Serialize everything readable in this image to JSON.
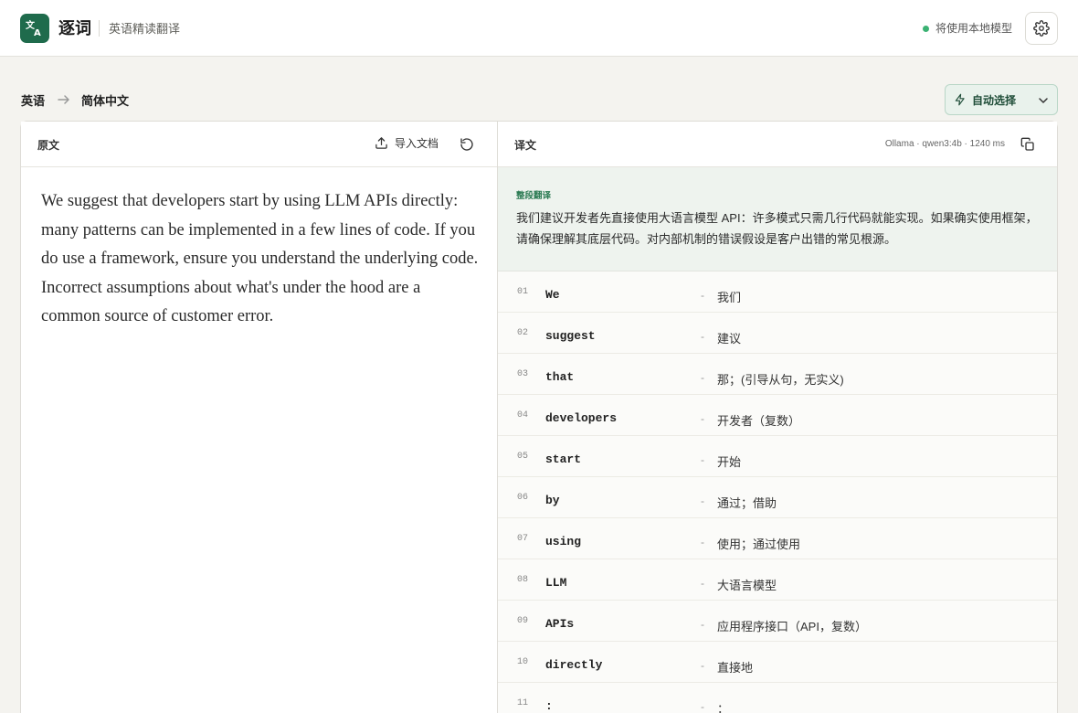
{
  "app": {
    "name": "逐词",
    "tagline": "英语精读翻译",
    "status_text": "将使用本地模型",
    "status_color": "#3bb273",
    "brand_color": "#1f6b4c",
    "logo_icon": "translate-icon",
    "settings_icon": "gear-icon"
  },
  "language": {
    "source": "英语",
    "target": "简体中文",
    "arrow_icon": "arrow-right-icon"
  },
  "model_select": {
    "label": "自动选择",
    "icon": "lightning-icon"
  },
  "source_panel": {
    "title": "原文",
    "import_label": "导入文档",
    "import_icon": "upload-icon",
    "reset_icon": "reset-icon",
    "text": "We suggest that developers start by using LLM APIs directly: many patterns can be implemented in a few lines of code. If you do use a framework, ensure you understand the underlying code. Incorrect assumptions about what's under the hood are a common source of customer error."
  },
  "translation_panel": {
    "title": "译文",
    "meta": "Ollama · qwen3:4b · 1240 ms",
    "copy_icon": "copy-icon",
    "full_label": "整段翻译",
    "full_text": "我们建议开发者先直接使用大语言模型 API：许多模式只需几行代码就能实现。如果确实使用框架，请确保理解其底层代码。对内部机制的错误假设是客户出错的常见根源。",
    "words": [
      {
        "num": "01",
        "en": "We",
        "zh": "我们"
      },
      {
        "num": "02",
        "en": "suggest",
        "zh": "建议"
      },
      {
        "num": "03",
        "en": "that",
        "zh": "那；(引导从句，无实义)"
      },
      {
        "num": "04",
        "en": "developers",
        "zh": "开发者（复数）"
      },
      {
        "num": "05",
        "en": "start",
        "zh": "开始"
      },
      {
        "num": "06",
        "en": "by",
        "zh": "通过；借助"
      },
      {
        "num": "07",
        "en": "using",
        "zh": "使用；通过使用"
      },
      {
        "num": "08",
        "en": "LLM",
        "zh": "大语言模型"
      },
      {
        "num": "09",
        "en": "APIs",
        "zh": "应用程序接口（API，复数）"
      },
      {
        "num": "10",
        "en": "directly",
        "zh": "直接地"
      },
      {
        "num": "11",
        "en": ":",
        "zh": "："
      }
    ]
  }
}
